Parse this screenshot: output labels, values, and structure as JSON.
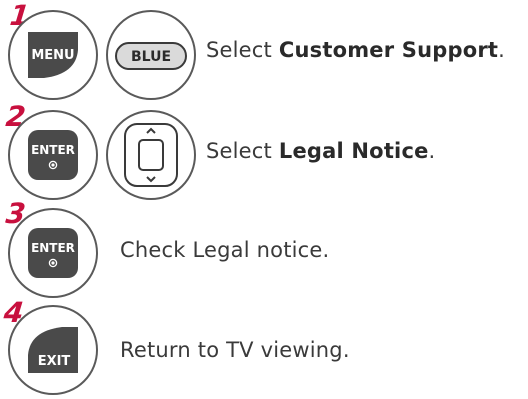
{
  "steps": [
    {
      "number": "1",
      "buttons": [
        "MENU",
        "BLUE"
      ],
      "text_prefix": "Select ",
      "text_bold": "Customer Support",
      "text_suffix": "."
    },
    {
      "number": "2",
      "buttons": [
        "ENTER",
        "navigation-pad"
      ],
      "text_prefix": "Select ",
      "text_bold": "Legal Notice",
      "text_suffix": "."
    },
    {
      "number": "3",
      "buttons": [
        "ENTER"
      ],
      "text_prefix": "Check Legal notice.",
      "text_bold": "",
      "text_suffix": ""
    },
    {
      "number": "4",
      "buttons": [
        "EXIT"
      ],
      "text_prefix": "Return to TV viewing.",
      "text_bold": "",
      "text_suffix": ""
    }
  ],
  "colors": {
    "step_number": "#c8103e",
    "key_fill": "#4a4a4a",
    "outline": "#5a5a5a",
    "text": "#3a3a3a"
  }
}
